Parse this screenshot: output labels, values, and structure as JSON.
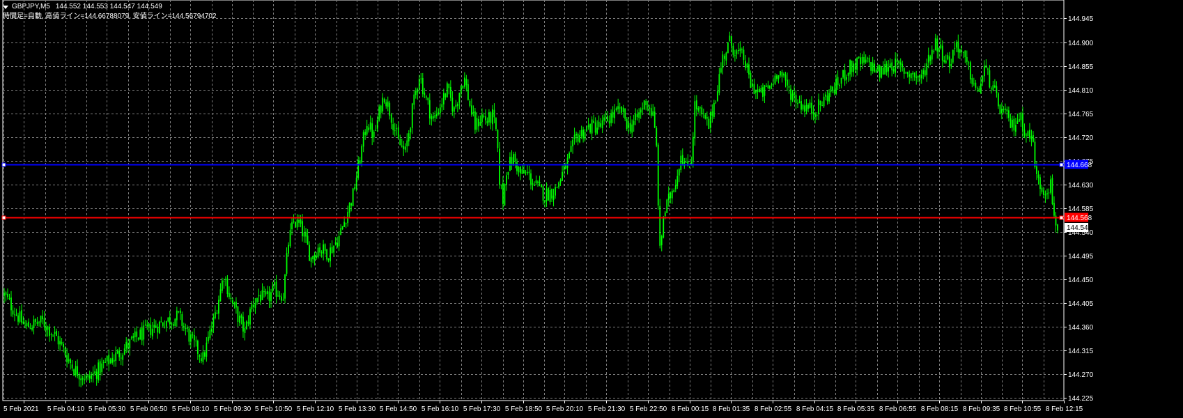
{
  "header": {
    "symbol": "GBPJPY,M5",
    "ohlc": "144.552 144.553 144.547 144.549",
    "indicator": "時間足=自動, 高値ライン=144.66788079, 安値ライン=144.56794702"
  },
  "colors": {
    "background": "#000000",
    "grid": "#808080",
    "candle": "#00ff00",
    "high_line": "#0000ff",
    "low_line": "#ff0000",
    "axis_text": "#ffffff"
  },
  "chart_data": {
    "type": "candlestick",
    "ylim": [
      144.22,
      144.98
    ],
    "y_ticks": [
      "144.945",
      "144.900",
      "144.855",
      "144.810",
      "144.765",
      "144.720",
      "144.675",
      "144.630",
      "144.585",
      "144.540",
      "144.495",
      "144.450",
      "144.405",
      "144.360",
      "144.315",
      "144.270",
      "144.225"
    ],
    "x_ticks": [
      "5 Feb 2021",
      "5 Feb 04:10",
      "5 Feb 05:30",
      "5 Feb 06:50",
      "5 Feb 08:10",
      "5 Feb 09:30",
      "5 Feb 10:50",
      "5 Feb 12:10",
      "5 Feb 13:30",
      "5 Feb 14:50",
      "5 Feb 16:10",
      "5 Feb 17:30",
      "5 Feb 18:50",
      "5 Feb 20:10",
      "5 Feb 21:30",
      "5 Feb 22:50",
      "8 Feb 00:15",
      "8 Feb 01:35",
      "8 Feb 02:55",
      "8 Feb 04:15",
      "8 Feb 05:35",
      "8 Feb 06:55",
      "8 Feb 08:15",
      "8 Feb 09:35",
      "8 Feb 10:55",
      "8 Feb 12:15"
    ],
    "high_line": {
      "value": 144.668,
      "label": "144.668"
    },
    "low_line": {
      "value": 144.568,
      "label": "144.568"
    },
    "current_price": {
      "value": 144.549,
      "label": "144.549"
    },
    "close_path": [
      [
        0,
        144.42
      ],
      [
        12,
        144.36
      ],
      [
        22,
        144.37
      ],
      [
        30,
        144.34
      ],
      [
        40,
        144.28
      ],
      [
        48,
        144.26
      ],
      [
        58,
        144.29
      ],
      [
        66,
        144.31
      ],
      [
        76,
        144.34
      ],
      [
        86,
        144.36
      ],
      [
        92,
        144.37
      ],
      [
        100,
        144.38
      ],
      [
        108,
        144.33
      ],
      [
        114,
        144.3
      ],
      [
        120,
        144.37
      ],
      [
        126,
        144.46
      ],
      [
        130,
        144.41
      ],
      [
        134,
        144.38
      ],
      [
        138,
        144.35
      ],
      [
        142,
        144.4
      ],
      [
        146,
        144.42
      ],
      [
        150,
        144.41
      ],
      [
        155,
        144.43
      ],
      [
        160,
        144.42
      ],
      [
        163,
        144.52
      ],
      [
        166,
        144.56
      ],
      [
        170,
        144.55
      ],
      [
        172,
        144.53
      ],
      [
        176,
        144.49
      ],
      [
        180,
        144.51
      ],
      [
        186,
        144.5
      ],
      [
        192,
        144.53
      ],
      [
        196,
        144.57
      ],
      [
        200,
        144.61
      ],
      [
        204,
        144.68
      ],
      [
        208,
        144.75
      ],
      [
        212,
        144.72
      ],
      [
        216,
        144.78
      ],
      [
        218,
        144.8
      ],
      [
        222,
        144.76
      ],
      [
        226,
        144.71
      ],
      [
        230,
        144.69
      ],
      [
        234,
        144.77
      ],
      [
        238,
        144.84
      ],
      [
        242,
        144.79
      ],
      [
        246,
        144.75
      ],
      [
        250,
        144.78
      ],
      [
        254,
        144.81
      ],
      [
        258,
        144.77
      ],
      [
        262,
        144.82
      ],
      [
        264,
        144.83
      ],
      [
        267,
        144.78
      ],
      [
        270,
        144.74
      ],
      [
        274,
        144.76
      ],
      [
        277,
        144.75
      ],
      [
        280,
        144.76
      ],
      [
        282,
        144.73
      ],
      [
        284,
        144.64
      ],
      [
        286,
        144.6
      ],
      [
        288,
        144.66
      ],
      [
        292,
        144.68
      ],
      [
        296,
        144.65
      ],
      [
        300,
        144.65
      ],
      [
        304,
        144.63
      ],
      [
        310,
        144.61
      ],
      [
        316,
        144.62
      ],
      [
        320,
        144.65
      ],
      [
        324,
        144.68
      ],
      [
        328,
        144.72
      ],
      [
        332,
        144.73
      ],
      [
        336,
        144.74
      ],
      [
        342,
        144.74
      ],
      [
        348,
        144.76
      ],
      [
        354,
        144.77
      ],
      [
        358,
        144.74
      ],
      [
        362,
        144.75
      ],
      [
        368,
        144.79
      ],
      [
        372,
        144.76
      ],
      [
        374,
        144.7
      ],
      [
        376,
        144.5
      ],
      [
        378,
        144.57
      ],
      [
        382,
        144.61
      ],
      [
        386,
        144.65
      ],
      [
        388,
        144.69
      ],
      [
        391,
        144.66
      ],
      [
        394,
        144.68
      ],
      [
        396,
        144.78
      ],
      [
        400,
        144.76
      ],
      [
        404,
        144.74
      ],
      [
        408,
        144.8
      ],
      [
        412,
        144.87
      ],
      [
        416,
        144.9
      ],
      [
        420,
        144.88
      ],
      [
        424,
        144.87
      ],
      [
        428,
        144.82
      ],
      [
        434,
        144.8
      ],
      [
        440,
        144.82
      ],
      [
        444,
        144.85
      ],
      [
        448,
        144.82
      ],
      [
        452,
        144.8
      ],
      [
        458,
        144.78
      ],
      [
        464,
        144.77
      ],
      [
        468,
        144.78
      ],
      [
        472,
        144.8
      ],
      [
        478,
        144.82
      ],
      [
        484,
        144.85
      ],
      [
        490,
        144.86
      ],
      [
        496,
        144.86
      ],
      [
        502,
        144.84
      ],
      [
        508,
        144.86
      ],
      [
        514,
        144.85
      ],
      [
        520,
        144.84
      ],
      [
        526,
        144.83
      ],
      [
        530,
        144.87
      ],
      [
        534,
        144.9
      ],
      [
        538,
        144.88
      ],
      [
        542,
        144.86
      ],
      [
        546,
        144.9
      ],
      [
        550,
        144.87
      ],
      [
        554,
        144.84
      ],
      [
        558,
        144.8
      ],
      [
        562,
        144.85
      ],
      [
        566,
        144.82
      ],
      [
        570,
        144.78
      ],
      [
        574,
        144.76
      ],
      [
        578,
        144.74
      ],
      [
        582,
        144.76
      ],
      [
        586,
        144.73
      ],
      [
        590,
        144.71
      ],
      [
        592,
        144.64
      ],
      [
        596,
        144.62
      ],
      [
        600,
        144.63
      ],
      [
        602,
        144.57
      ],
      [
        604,
        144.55
      ]
    ],
    "candle_count": 605
  }
}
